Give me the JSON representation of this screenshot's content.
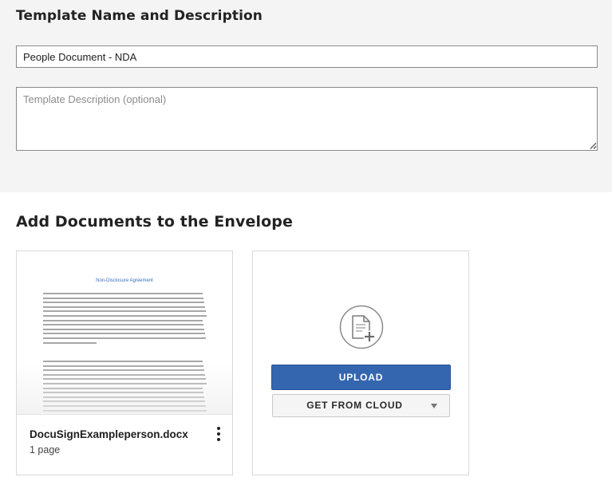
{
  "template_section": {
    "title": "Template Name and Description",
    "name_value": "People Document - NDA",
    "description_placeholder": "Template Description (optional)"
  },
  "documents_section": {
    "title": "Add Documents to the Envelope",
    "document": {
      "filename": "DocuSignExampleperson.docx",
      "pages": "1 page",
      "preview_title": "Non-Disclosure Agreement",
      "icons": {
        "menu": "kebab-menu-icon"
      }
    },
    "upload": {
      "upload_label": "UPLOAD",
      "cloud_label": "GET FROM CLOUD",
      "icons": {
        "add": "add-document-icon",
        "dropdown": "caret-down-icon"
      }
    }
  },
  "colors": {
    "primary_button": "#3466b0",
    "section_background": "#f4f4f4"
  }
}
